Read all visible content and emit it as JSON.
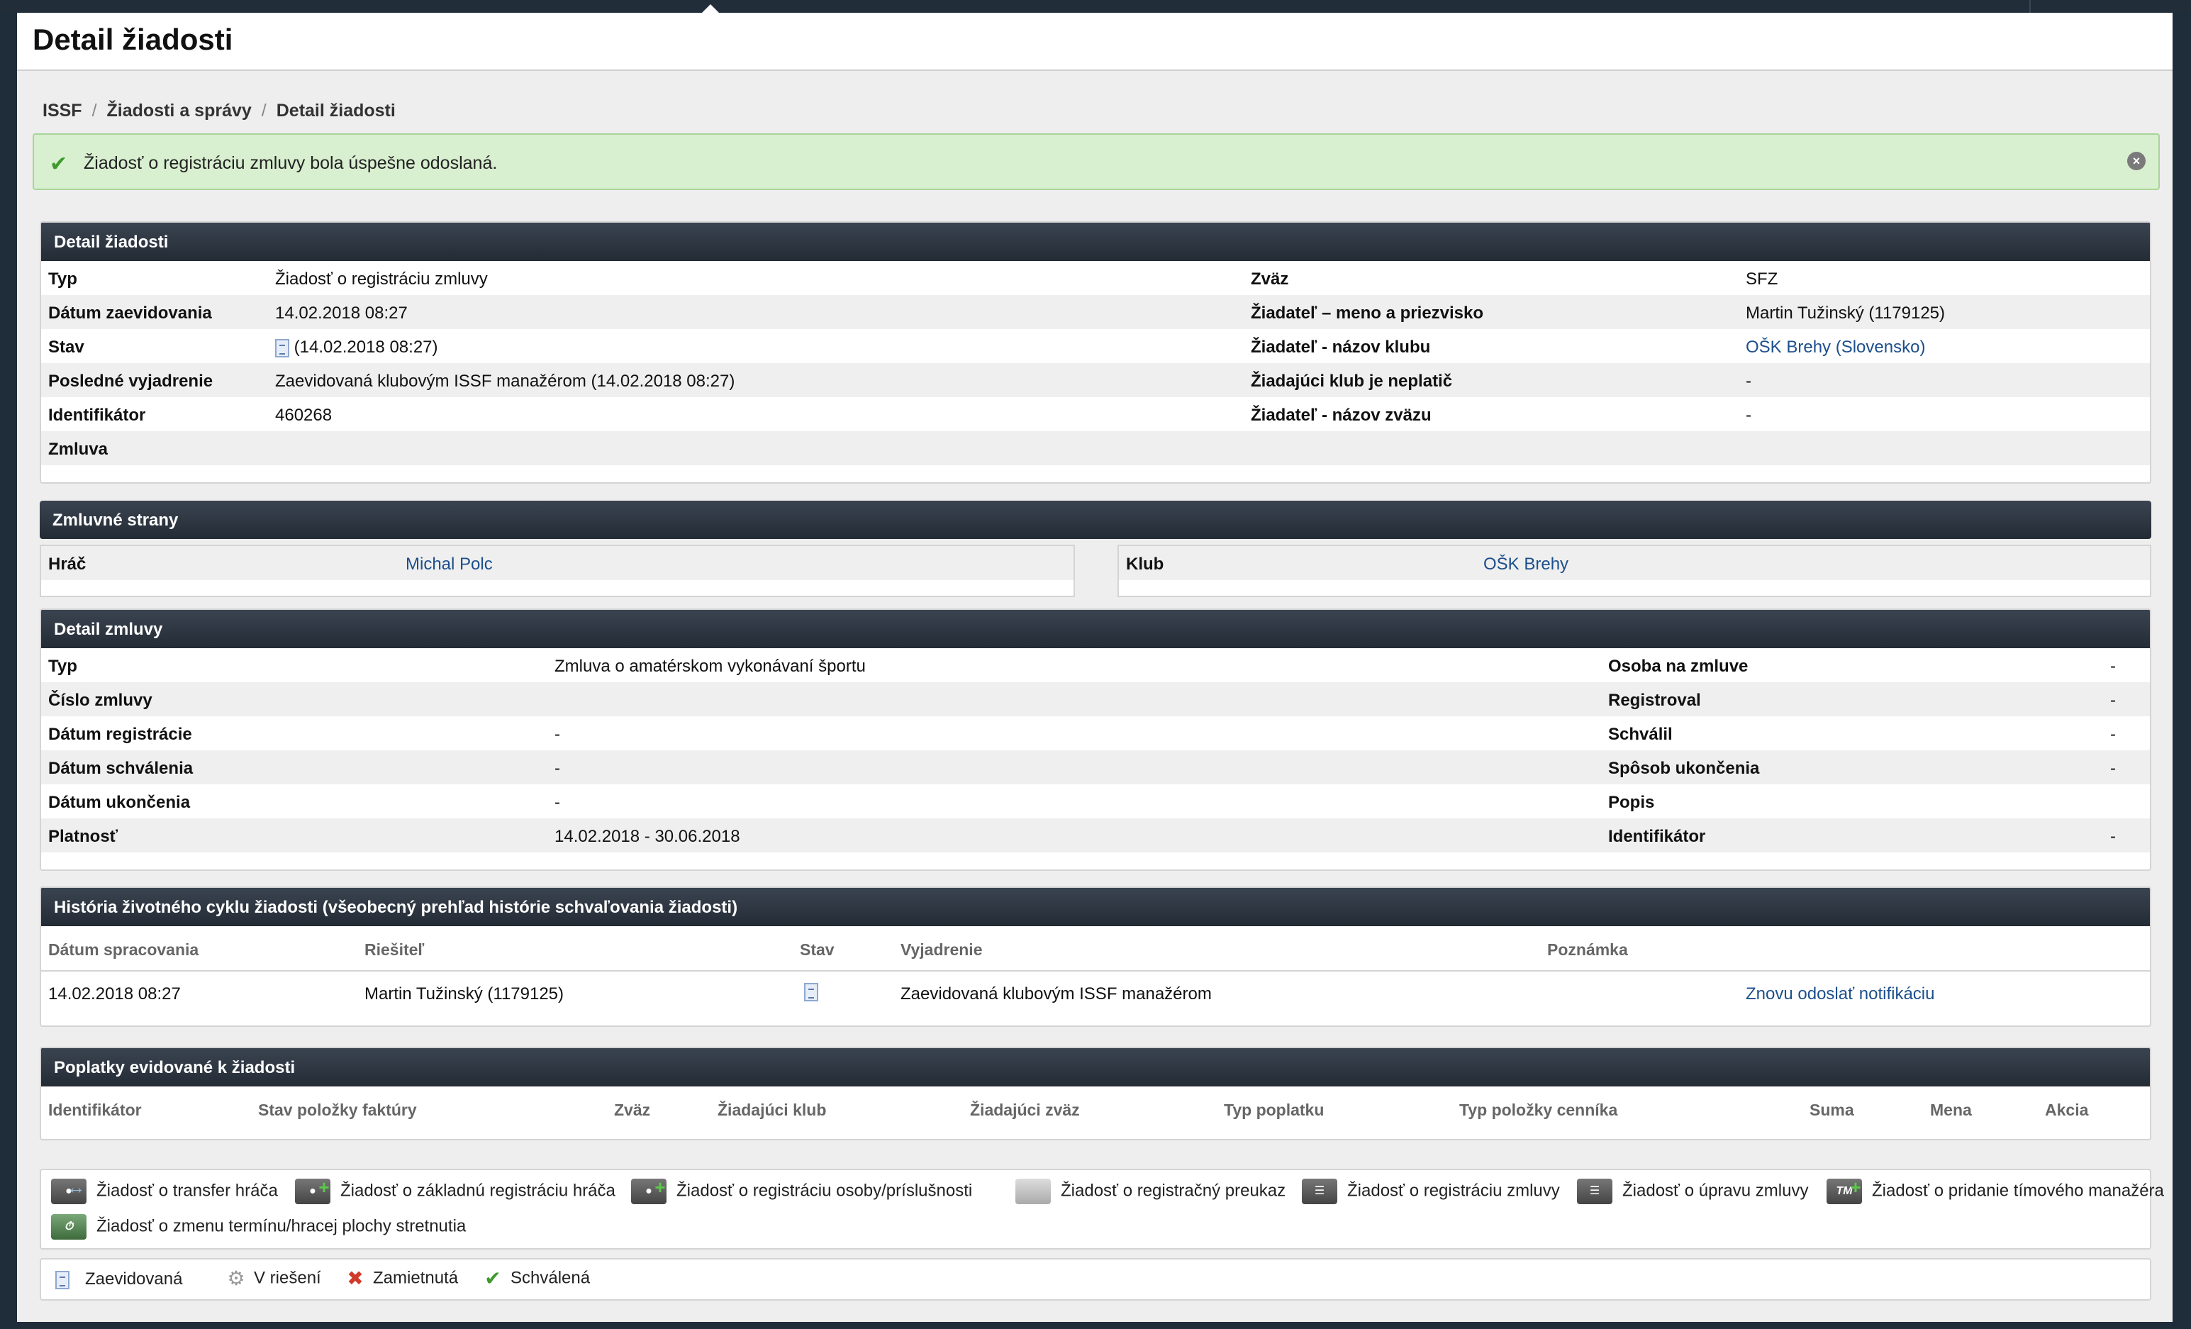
{
  "page": {
    "title": "Detail žiadosti"
  },
  "breadcrumb": [
    "ISSF",
    "Žiadosti a správy",
    "Detail žiadosti"
  ],
  "alert": {
    "message": "Žiadosť o registráciu zmluvy bola úspešne odoslaná.",
    "color": "#d8efd0"
  },
  "request_detail": {
    "heading": "Detail žiadosti",
    "left": [
      {
        "label": "Typ",
        "value": "Žiadosť o registráciu zmluvy"
      },
      {
        "label": "Dátum zaevidovania",
        "value": "14.02.2018 08:27"
      },
      {
        "label": "Stav",
        "value": "(14.02.2018 08:27)"
      },
      {
        "label": "Posledné vyjadrenie",
        "value": "Zaevidovaná klubovým ISSF manažérom (14.02.2018 08:27)"
      },
      {
        "label": "Identifikátor",
        "value": "460268"
      },
      {
        "label": "Zmluva",
        "value": ""
      }
    ],
    "right": [
      {
        "label": "Zväz",
        "value": "SFZ"
      },
      {
        "label": "Žiadateľ – meno a priezvisko",
        "value": "Martin Tužinský (1179125)"
      },
      {
        "label": "Žiadateľ - názov klubu",
        "value": "OŠK Brehy (Slovensko)"
      },
      {
        "label": "Žiadajúci klub je neplatič",
        "value": "-"
      },
      {
        "label": "Žiadateľ - názov zväzu",
        "value": "-"
      }
    ]
  },
  "contract_parties": {
    "heading": "Zmluvné strany",
    "player": {
      "label": "Hráč",
      "value": "Michal Polc"
    },
    "club": {
      "label": "Klub",
      "value": "OŠK Brehy"
    }
  },
  "contract_detail": {
    "heading": "Detail zmluvy",
    "left": [
      {
        "label": "Typ",
        "value": "Zmluva o amatérskom vykonávaní športu"
      },
      {
        "label": "Číslo zmluvy",
        "value": ""
      },
      {
        "label": "Dátum registrácie",
        "value": "-"
      },
      {
        "label": "Dátum schválenia",
        "value": "-"
      },
      {
        "label": "Dátum ukončenia",
        "value": "-"
      },
      {
        "label": "Platnosť",
        "value": "14.02.2018 - 30.06.2018"
      }
    ],
    "right": [
      {
        "label": "Osoba na zmluve",
        "value": "-"
      },
      {
        "label": "Registroval",
        "value": "-"
      },
      {
        "label": "Schválil",
        "value": "-"
      },
      {
        "label": "Spôsob ukončenia",
        "value": "-"
      },
      {
        "label": "Popis",
        "value": ""
      },
      {
        "label": "Identifikátor",
        "value": "-"
      }
    ]
  },
  "history": {
    "heading": "História životného cyklu žiadosti (všeobecný prehľad histórie schvaľovania žiadosti)",
    "columns": [
      "Dátum spracovania",
      "Riešiteľ",
      "Stav",
      "Vyjadrenie",
      "Poznámka"
    ],
    "rows": [
      {
        "date": "14.02.2018 08:27",
        "resolver": "Martin Tužinský (1179125)",
        "status_icon": "document-icon",
        "statement": "Zaevidovaná klubovým ISSF manažérom",
        "action": "Znovu odoslať notifikáciu"
      }
    ]
  },
  "fees": {
    "heading": "Poplatky evidované k žiadosti",
    "columns": [
      "Identifikátor",
      "Stav položky faktúry",
      "Zväz",
      "Žiadajúci klub",
      "Žiadajúci zväz",
      "Typ poplatku",
      "Typ položky cenníka",
      "Suma",
      "Mena",
      "Akcia"
    ]
  },
  "request_types_legend": [
    {
      "icon": "user-transfer-icon",
      "label": "Žiadosť o transfer hráča"
    },
    {
      "icon": "user-add-icon",
      "label": "Žiadosť o základnú registráciu hráča"
    },
    {
      "icon": "person-add-icon",
      "label": "Žiadosť o registráciu osoby/príslušnosti"
    },
    {
      "icon": "card-icon",
      "label": "Žiadosť o registračný preukaz"
    },
    {
      "icon": "contract-icon",
      "label": "Žiadosť o registráciu zmluvy"
    },
    {
      "icon": "contract-edit-icon",
      "label": "Žiadosť o úpravu zmluvy"
    },
    {
      "icon": "team-manager-icon",
      "label": "Žiadosť o pridanie tímového manažéra"
    },
    {
      "icon": "schedule-change-icon",
      "label": "Žiadosť o zmenu termínu/hracej plochy stretnutia"
    }
  ],
  "status_legend": [
    {
      "icon": "document-icon",
      "label": "Zaevidovaná"
    },
    {
      "icon": "gear-icon",
      "label": "V riešení"
    },
    {
      "icon": "cross-icon",
      "label": "Zamietnutá",
      "color": "#d03a2a"
    },
    {
      "icon": "check-icon",
      "label": "Schválená",
      "color": "#3f9a2d"
    }
  ]
}
